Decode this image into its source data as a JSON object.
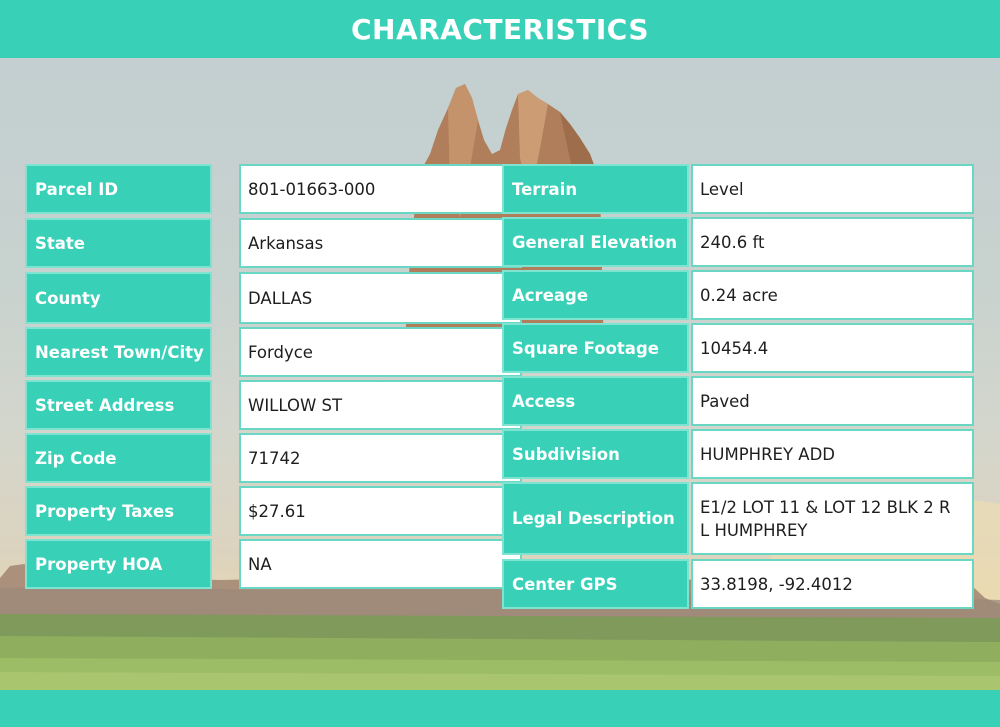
{
  "header": {
    "title": "CHARACTERISTICS"
  },
  "left_table": [
    {
      "label": "Parcel ID",
      "value": "801-01663-000"
    },
    {
      "label": "State",
      "value": "Arkansas"
    },
    {
      "label": "County",
      "value": "DALLAS"
    },
    {
      "label": "Nearest Town/City",
      "value": "Fordyce"
    },
    {
      "label": "Street Address",
      "value": "WILLOW ST"
    },
    {
      "label": "Zip Code",
      "value": "71742"
    },
    {
      "label": "Property Taxes",
      "value": "$27.61"
    },
    {
      "label": "Property HOA",
      "value": "NA"
    }
  ],
  "right_table": [
    {
      "label": "Terrain",
      "value": "Level"
    },
    {
      "label": "General Elevation",
      "value": "240.6 ft"
    },
    {
      "label": "Acreage",
      "value": "0.24 acre"
    },
    {
      "label": "Square Footage",
      "value": "10454.4"
    },
    {
      "label": "Access",
      "value": "Paved"
    },
    {
      "label": "Subdivision",
      "value": "HUMPHREY ADD"
    },
    {
      "label": "Legal Description",
      "value": "E1/2 LOT 11 & LOT 12 BLK 2 R L HUMPHREY"
    },
    {
      "label": "Center GPS",
      "value": "33.8198, -92.4012"
    }
  ],
  "colors": {
    "accent": "#39d0b8",
    "value_background": "#ffffff",
    "value_text": "#1e1e1e",
    "label_text": "#ffffff"
  }
}
